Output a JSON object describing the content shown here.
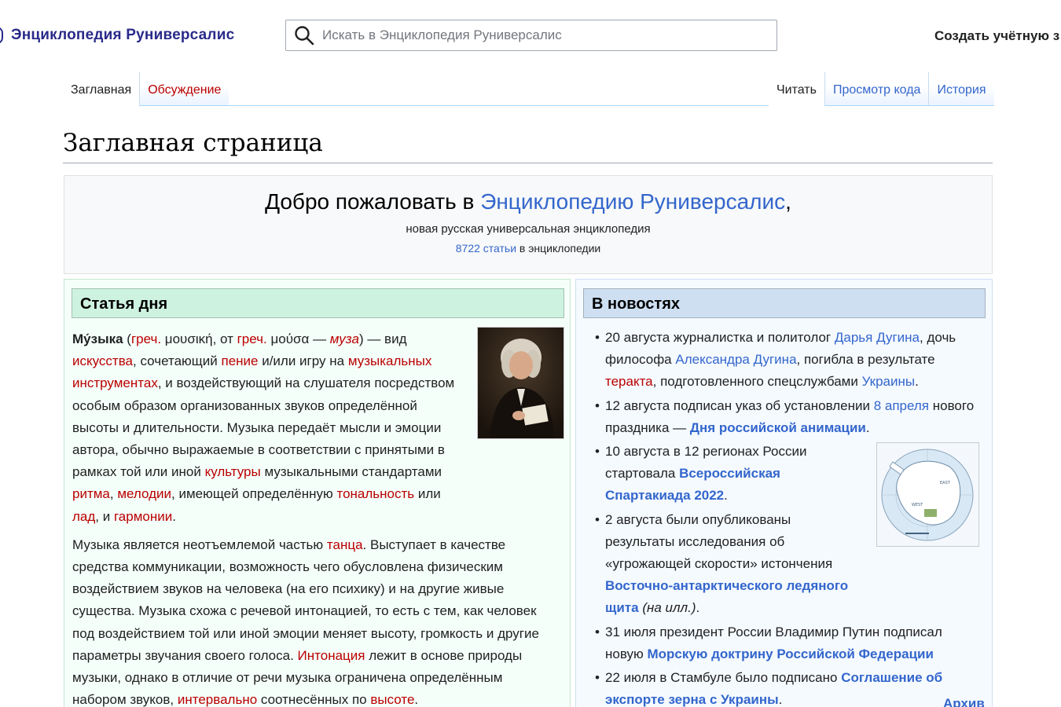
{
  "header": {
    "site_title": "Энциклопедия Руниверсалис",
    "search_placeholder": "Искать в Энциклопедия Руниверсалис",
    "create_account": "Создать учётную з"
  },
  "tabs": {
    "left": [
      {
        "label": "Заглавная",
        "selected": true
      },
      {
        "label": "Обсуждение",
        "selected": false
      }
    ],
    "right": [
      {
        "label": "Читать",
        "selected": true
      },
      {
        "label": "Просмотр кода",
        "selected": false
      },
      {
        "label": "История",
        "selected": false
      }
    ]
  },
  "page_title": "Заглавная страница",
  "welcome": {
    "prefix": "Добро пожаловать в ",
    "link": "Энциклопедию Руниверсалис",
    "suffix": ",",
    "subtitle": "новая русская универсальная энциклопедия",
    "count_link": "8722 статьи",
    "count_suffix": " в энциклопедии"
  },
  "article_of_day": {
    "heading": "Статья дня",
    "p1": [
      {
        "t": "Му́зыка",
        "s": "bold"
      },
      {
        "t": " (",
        "s": ""
      },
      {
        "t": "греч.",
        "s": "red"
      },
      {
        "t": " μουσική, от ",
        "s": ""
      },
      {
        "t": "греч.",
        "s": "red"
      },
      {
        "t": " μούσα — ",
        "s": ""
      },
      {
        "t": "муза",
        "s": "red-italic"
      },
      {
        "t": ") — вид ",
        "s": ""
      },
      {
        "t": "искусства",
        "s": "red"
      },
      {
        "t": ", сочетающий ",
        "s": ""
      },
      {
        "t": "пение",
        "s": "red"
      },
      {
        "t": " и/или игру на ",
        "s": ""
      },
      {
        "t": "музыкальных инструментах",
        "s": "red"
      },
      {
        "t": ", и воздействующий на слушателя посредством особым образом организованных звуков определённой высоты и длительности. Музыка передаёт мысли и эмоции автора, обычно выражаемые в соответствии с принятыми в рамках той или иной ",
        "s": ""
      },
      {
        "t": "культуры",
        "s": "red"
      },
      {
        "t": " музыкальными стандартами ",
        "s": ""
      },
      {
        "t": "ритма",
        "s": "red"
      },
      {
        "t": ", ",
        "s": ""
      },
      {
        "t": "мелодии",
        "s": "red"
      },
      {
        "t": ", имеющей определённую ",
        "s": ""
      },
      {
        "t": "тональность",
        "s": "red"
      },
      {
        "t": " или ",
        "s": ""
      },
      {
        "t": "лад",
        "s": "red"
      },
      {
        "t": ", и ",
        "s": ""
      },
      {
        "t": "гармонии",
        "s": "red"
      },
      {
        "t": ".",
        "s": ""
      }
    ],
    "p2": [
      {
        "t": "Музыка является неотъемлемой частью ",
        "s": ""
      },
      {
        "t": "танца",
        "s": "red"
      },
      {
        "t": ". Выступает в качестве средства коммуникации, возможность чего обусловлена физическим воздействием звуков на человека (на его психику) и на другие живые существа. Музыка схожа с речевой интонацией, то есть с тем, как человек под воздействием той или иной эмоции меняет высоту, громкость и другие параметры звучания своего голоса. ",
        "s": ""
      },
      {
        "t": "Интонация",
        "s": "red"
      },
      {
        "t": " лежит в основе природы музыки, однако в отличие от речи музыка ограничена определённым набором звуков, ",
        "s": ""
      },
      {
        "t": "интервально",
        "s": "red"
      },
      {
        "t": " соотнесённых по ",
        "s": ""
      },
      {
        "t": "высоте",
        "s": "red"
      },
      {
        "t": ".",
        "s": ""
      }
    ]
  },
  "news": {
    "heading": "В новостях",
    "items": [
      [
        {
          "t": "20 августа журналистка и политолог ",
          "s": ""
        },
        {
          "t": "Дарья Дугина",
          "s": "blue"
        },
        {
          "t": ", дочь философа ",
          "s": ""
        },
        {
          "t": "Александра Дугина",
          "s": "blue"
        },
        {
          "t": ", погибла в результате ",
          "s": ""
        },
        {
          "t": "теракта",
          "s": "red"
        },
        {
          "t": ", подготовленного спецслужбами ",
          "s": ""
        },
        {
          "t": "Украины",
          "s": "blue"
        },
        {
          "t": ".",
          "s": ""
        }
      ],
      [
        {
          "t": "12 августа подписан указ об установлении ",
          "s": ""
        },
        {
          "t": "8 апреля",
          "s": "blue"
        },
        {
          "t": " нового праздника — ",
          "s": ""
        },
        {
          "t": "Дня российской анимации",
          "s": "blue-bold"
        },
        {
          "t": ".",
          "s": ""
        }
      ],
      [
        {
          "t": "10 августа в 12 регионах России стартовала ",
          "s": ""
        },
        {
          "t": "Всероссийская Спартакиада 2022",
          "s": "blue-bold"
        },
        {
          "t": ".",
          "s": ""
        }
      ],
      [
        {
          "t": "2 августа были опубликованы результаты исследования об «угрожающей скорости» истончения ",
          "s": ""
        },
        {
          "t": "Восточно-антарктического ледяного щита",
          "s": "blue-bold"
        },
        {
          "t": " ",
          "s": ""
        },
        {
          "t": "(на илл.)",
          "s": "italic"
        },
        {
          "t": ".",
          "s": ""
        }
      ],
      [
        {
          "t": "31 июля президент России Владимир Путин подписал новую ",
          "s": ""
        },
        {
          "t": "Морскую доктрину Российской Федерации",
          "s": "blue-bold"
        }
      ],
      [
        {
          "t": "22 июля в Стамбуле было подписано ",
          "s": ""
        },
        {
          "t": "Соглашение об экспорте зерна с Украины",
          "s": "blue-bold"
        },
        {
          "t": ".",
          "s": ""
        }
      ]
    ],
    "archive": "Архив"
  },
  "colors": {
    "link": "#3366cc",
    "redlink": "#ba0000",
    "article_bg": "#f5fffa",
    "article_header": "#cef2e0",
    "news_bg": "#f5faff",
    "news_header": "#cedff2"
  },
  "images": {
    "portrait": "portrait-image",
    "map": "antarctica-map-image"
  }
}
